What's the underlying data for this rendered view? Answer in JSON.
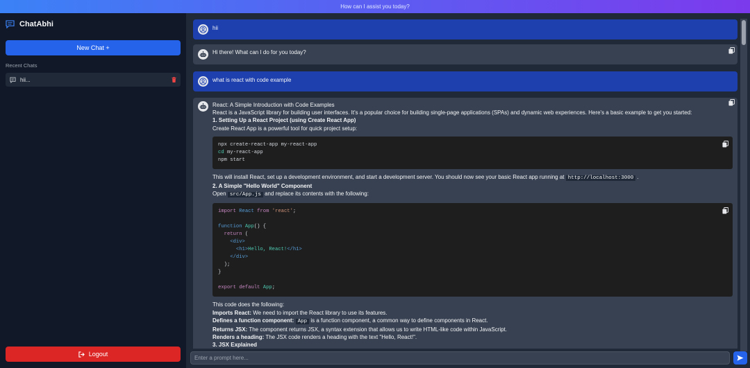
{
  "topbar": {
    "text": "How can I assist you today?"
  },
  "sidebar": {
    "brand": "ChatAbhi",
    "new_chat_label": "New Chat +",
    "recent_title": "Recent Chats",
    "recent_items": [
      {
        "label": "hii..."
      }
    ],
    "logout_label": "Logout"
  },
  "messages": [
    {
      "role": "user",
      "text": "hii"
    },
    {
      "role": "bot",
      "text": "Hi there! What can I do for you today?"
    },
    {
      "role": "user",
      "text": "what is react with code example"
    },
    {
      "role": "bot",
      "title": "React: A Simple Introduction with Code Examples",
      "intro": "React is a JavaScript library for building user interfaces. It's a popular choice for building single-page applications (SPAs) and dynamic web experiences. Here's a basic example to get you started:",
      "h1": "1. Setting Up a React Project (using Create React App)",
      "p1": "Create React App is a powerful tool for quick project setup:",
      "code1": [
        "npx create-react-app my-react-app",
        "cd my-react-app",
        "npm start"
      ],
      "p2_pre": "This will install React, set up a development environment, and start a development server. You should now see your basic React app running at",
      "p2_code": "http://localhost:3000",
      "p2_post": ".",
      "h2": "2. A Simple \"Hello World\" Component",
      "p3_pre": "Open",
      "p3_code": "src/App.js",
      "p3_post": "and replace its contents with the following:",
      "code2": [
        "import React from 'react';",
        "",
        "function App() {",
        "  return (",
        "    <div>",
        "      <h1>Hello, React!</h1>",
        "    </div>",
        "  );",
        "}",
        "",
        "export default App;"
      ],
      "p4": "This code does the following:",
      "bullets": [
        {
          "bold": "Imports React:",
          "pre": "We need to import the React library to use its features.",
          "code": "",
          "post": ""
        },
        {
          "bold": "Defines a function component:",
          "pre": "",
          "code": "App",
          "post": "is a function component, a common way to define components in React."
        },
        {
          "bold": "Returns JSX:",
          "pre": "The component returns JSX, a syntax extension that allows us to write HTML-like code within JavaScript.",
          "code": "",
          "post": ""
        },
        {
          "bold": "Renders a heading:",
          "pre": "The JSX code renders a heading with the text \"Hello, React!\".",
          "code": "",
          "post": ""
        }
      ],
      "h3": "3. JSX Explained"
    }
  ],
  "input": {
    "placeholder": "Enter a prompt here..."
  },
  "colors": {
    "accent": "#2563eb",
    "danger": "#dc2626",
    "sidebar_bg": "#111827",
    "main_bg": "#1f2937",
    "user_bubble": "#1e40af",
    "bot_bubble": "#374151"
  }
}
